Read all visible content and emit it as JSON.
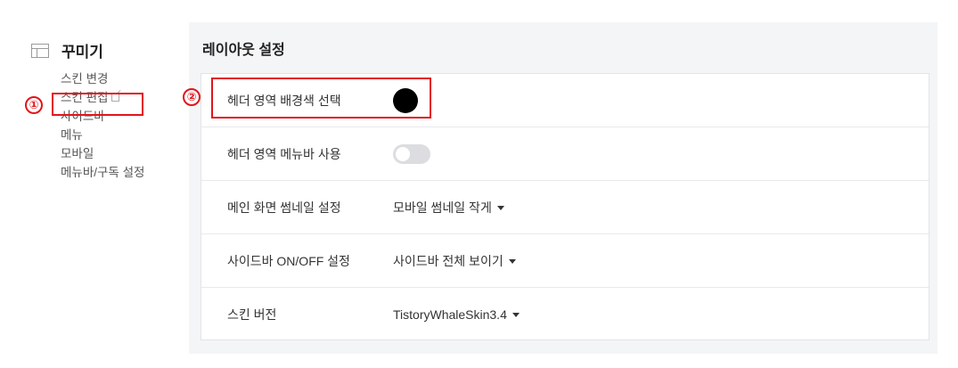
{
  "sidebar": {
    "section_title": "꾸미기",
    "section_icon": "layout-icon",
    "items": [
      {
        "label": "스킨 변경"
      },
      {
        "label": "스킨 편집",
        "icon": "external-link-icon"
      },
      {
        "label": "사이드바"
      },
      {
        "label": "메뉴"
      },
      {
        "label": "모바일"
      },
      {
        "label": "메뉴바/구독 설정"
      }
    ]
  },
  "annotations": {
    "marker_1": "①",
    "marker_2": "②",
    "highlight_color": "#e2151b"
  },
  "main": {
    "title": "레이아웃 설정",
    "rows": [
      {
        "label": "헤더 영역 배경색 선택",
        "control": "color-swatch",
        "value": "#000000"
      },
      {
        "label": "헤더 영역 메뉴바 사용",
        "control": "toggle",
        "value": "off"
      },
      {
        "label": "메인 화면 썸네일 설정",
        "control": "select",
        "value": "모바일 썸네일 작게"
      },
      {
        "label": "사이드바 ON/OFF 설정",
        "control": "select",
        "value": "사이드바 전체 보이기"
      },
      {
        "label": "스킨 버전",
        "control": "select",
        "value": "TistoryWhaleSkin3.4"
      }
    ]
  }
}
